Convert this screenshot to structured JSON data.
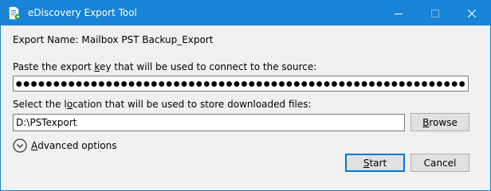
{
  "window": {
    "title": "eDiscovery Export Tool",
    "accent_color": "#1883d7",
    "icons": {
      "app": "export-tool-icon",
      "minimize": "minimize-icon",
      "maximize": "maximize-icon",
      "close": "close-icon"
    }
  },
  "export_name": "Export Name: Mailbox PST Backup_Export",
  "key": {
    "label_pre": "Paste the export ",
    "label_accel": "k",
    "label_post": "ey that will be used to connect to the source:",
    "masked": true
  },
  "location": {
    "label_pre": "Select the l",
    "label_accel": "o",
    "label_post": "cation that will be used to store downloaded files:",
    "value": "D:\\PSTexport"
  },
  "buttons": {
    "browse_accel": "B",
    "browse_rest": "rowse",
    "start_accel": "S",
    "start_rest": "tart",
    "cancel": "Cancel"
  },
  "advanced": {
    "accel": "A",
    "rest": "dvanced options",
    "icon": "chevron-down-circle-icon"
  }
}
